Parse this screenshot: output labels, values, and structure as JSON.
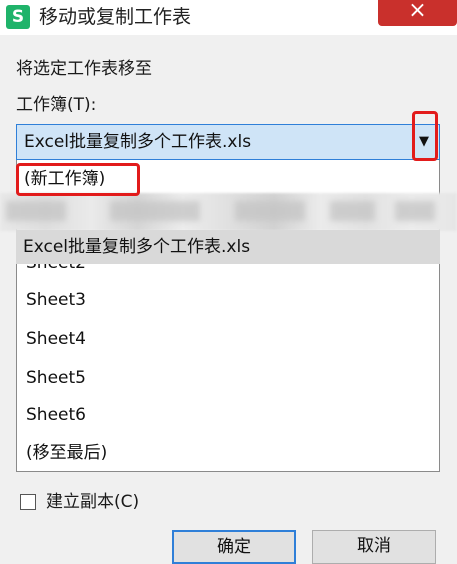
{
  "window": {
    "title": "移动或复制工作表",
    "app_icon_letter": "S",
    "app_icon_color": "#1fb36a",
    "close_label": "×",
    "close_color": "#c9302c"
  },
  "dialog": {
    "move_to_label": "将选定工作表移至",
    "workbook_label": "工作簿(T):",
    "workbook_value": "Excel批量复制多个工作表.xls",
    "dropdown_options": {
      "new_workbook": "(新工作簿)",
      "current": "Excel批量复制多个工作表.xls"
    },
    "sheets": [
      "Sheet2",
      "Sheet3",
      "Sheet4",
      "Sheet5",
      "Sheet6",
      "(移至最后)"
    ],
    "copy_checkbox": {
      "label": "建立副本(C)",
      "checked": false
    },
    "ok_label": "确定",
    "cancel_label": "取消",
    "highlight_color": "#e21b1b"
  }
}
